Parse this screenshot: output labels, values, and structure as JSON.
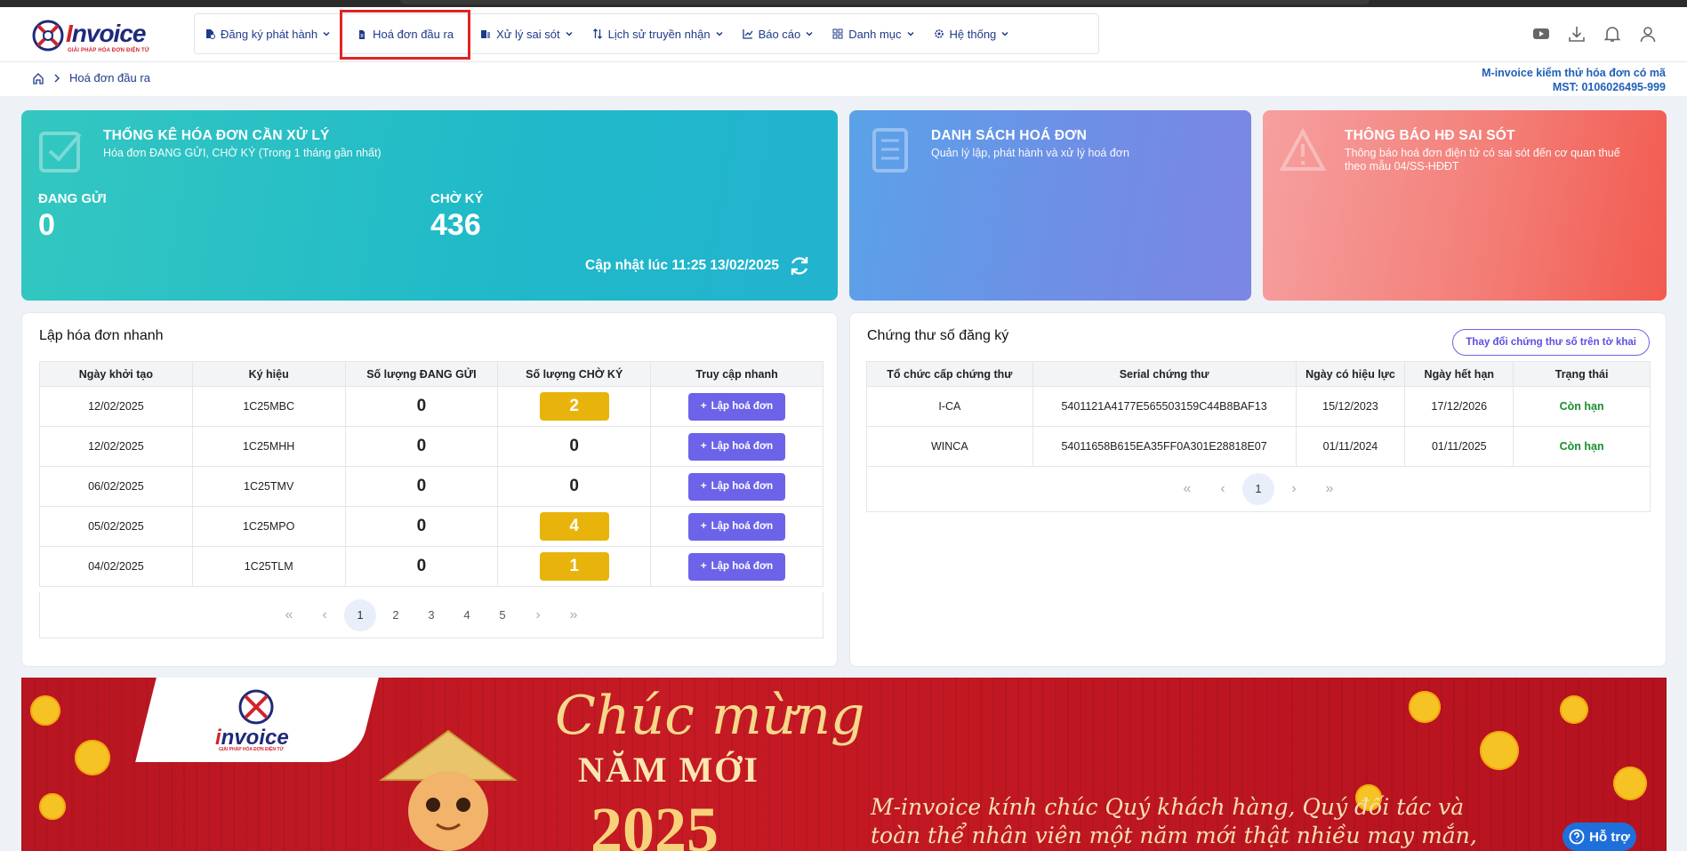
{
  "logo": {
    "word_left": "I",
    "word_rest": "nvoice",
    "tagline": "GIẢI PHÁP HÓA ĐƠN ĐIỆN TỬ"
  },
  "menu": [
    {
      "label": "Đăng ký phát hành",
      "icon": "file-register-icon",
      "has_dropdown": true
    },
    {
      "label": "Hoá đơn đầu ra",
      "icon": "invoice-file-icon",
      "has_dropdown": false,
      "highlighted": true
    },
    {
      "label": "Xử lý sai sót",
      "icon": "fix-error-icon",
      "has_dropdown": true
    },
    {
      "label": "Lịch sử truyền nhận",
      "icon": "transfer-arrows-icon",
      "has_dropdown": true
    },
    {
      "label": "Báo cáo",
      "icon": "chart-icon",
      "has_dropdown": true
    },
    {
      "label": "Danh mục",
      "icon": "grid-icon",
      "has_dropdown": true
    },
    {
      "label": "Hệ thống",
      "icon": "gear-icon",
      "has_dropdown": true
    }
  ],
  "tools": [
    "youtube-icon",
    "download-icon",
    "bell-icon",
    "user-icon"
  ],
  "breadcrumb": {
    "current": "Hoá đơn đầu ra"
  },
  "company": {
    "name": "M-invoice kiểm thử hóa đơn có mã",
    "tax_code": "MST: 0106026495-999"
  },
  "stats_card": {
    "title": "THỐNG KÊ HÓA ĐƠN CẦN XỬ LÝ",
    "subtitle": "Hóa đơn ĐANG GỬI, CHỜ KÝ (Trong 1 tháng gần nhất)",
    "sending_label": "ĐANG GỬI",
    "sending_value": "0",
    "pending_label": "CHỜ KÝ",
    "pending_value": "436",
    "updated": "Cập nhật lúc 11:25 13/02/2025"
  },
  "list_card": {
    "title": "DANH SÁCH HOÁ ĐƠN",
    "subtitle": "Quản lý lập, phát hành và xử lý hoá đơn"
  },
  "error_card": {
    "title": "THÔNG BÁO HĐ SAI SÓT",
    "subtitle": "Thông báo hoá đơn điện tử có sai sót đến cơ quan thuế theo mẫu 04/SS-HĐĐT"
  },
  "quick": {
    "title": "Lập hóa đơn nhanh",
    "headers": [
      "Ngày khởi tạo",
      "Ký hiệu",
      "Số lượng ĐANG GỬI",
      "Số lượng CHỜ KÝ",
      "Truy cập nhanh"
    ],
    "button_label": "Lập hoá đơn",
    "rows": [
      {
        "date": "12/02/2025",
        "symbol": "1C25MBC",
        "sending": "0",
        "pending": "2",
        "pending_badge": true
      },
      {
        "date": "12/02/2025",
        "symbol": "1C25MHH",
        "sending": "0",
        "pending": "0",
        "pending_badge": false
      },
      {
        "date": "06/02/2025",
        "symbol": "1C25TMV",
        "sending": "0",
        "pending": "0",
        "pending_badge": false
      },
      {
        "date": "05/02/2025",
        "symbol": "1C25MPO",
        "sending": "0",
        "pending": "4",
        "pending_badge": true
      },
      {
        "date": "04/02/2025",
        "symbol": "1C25TLM",
        "sending": "0",
        "pending": "1",
        "pending_badge": true
      }
    ],
    "pages": [
      "1",
      "2",
      "3",
      "4",
      "5"
    ],
    "current_page": "1"
  },
  "certs": {
    "title": "Chứng thư số đăng ký",
    "change_button": "Thay đổi chứng thư số trên tờ khai",
    "headers": [
      "Tổ chức cấp chứng thư",
      "Serial chứng thư",
      "Ngày có hiệu lực",
      "Ngày hết hạn",
      "Trạng thái"
    ],
    "rows": [
      {
        "org": "I-CA",
        "serial": "5401121A4177E565503159C44B8BAF13",
        "from": "15/12/2023",
        "to": "17/12/2026",
        "status": "Còn hạn"
      },
      {
        "org": "WINCA",
        "serial": "54011658B615EA35FF0A301E28818E07",
        "from": "01/11/2024",
        "to": "01/11/2025",
        "status": "Còn hạn"
      }
    ],
    "pages": [
      "1"
    ],
    "current_page": "1"
  },
  "banner": {
    "logo_word_left": "i",
    "logo_word_rest": "nvoice",
    "logo_tag": "GIẢI PHÁP HÓA ĐƠN ĐIỆN TỬ",
    "greet1": "Chúc mừng",
    "greet2": "NĂM MỚI",
    "year": "2025",
    "msg1": "M-invoice kính chúc Quý khách hàng, Quý đối tác và",
    "msg2": "toàn thể nhân viên một năm mới thật nhiều may mắn,"
  },
  "help_label": "Hỗ trợ"
}
